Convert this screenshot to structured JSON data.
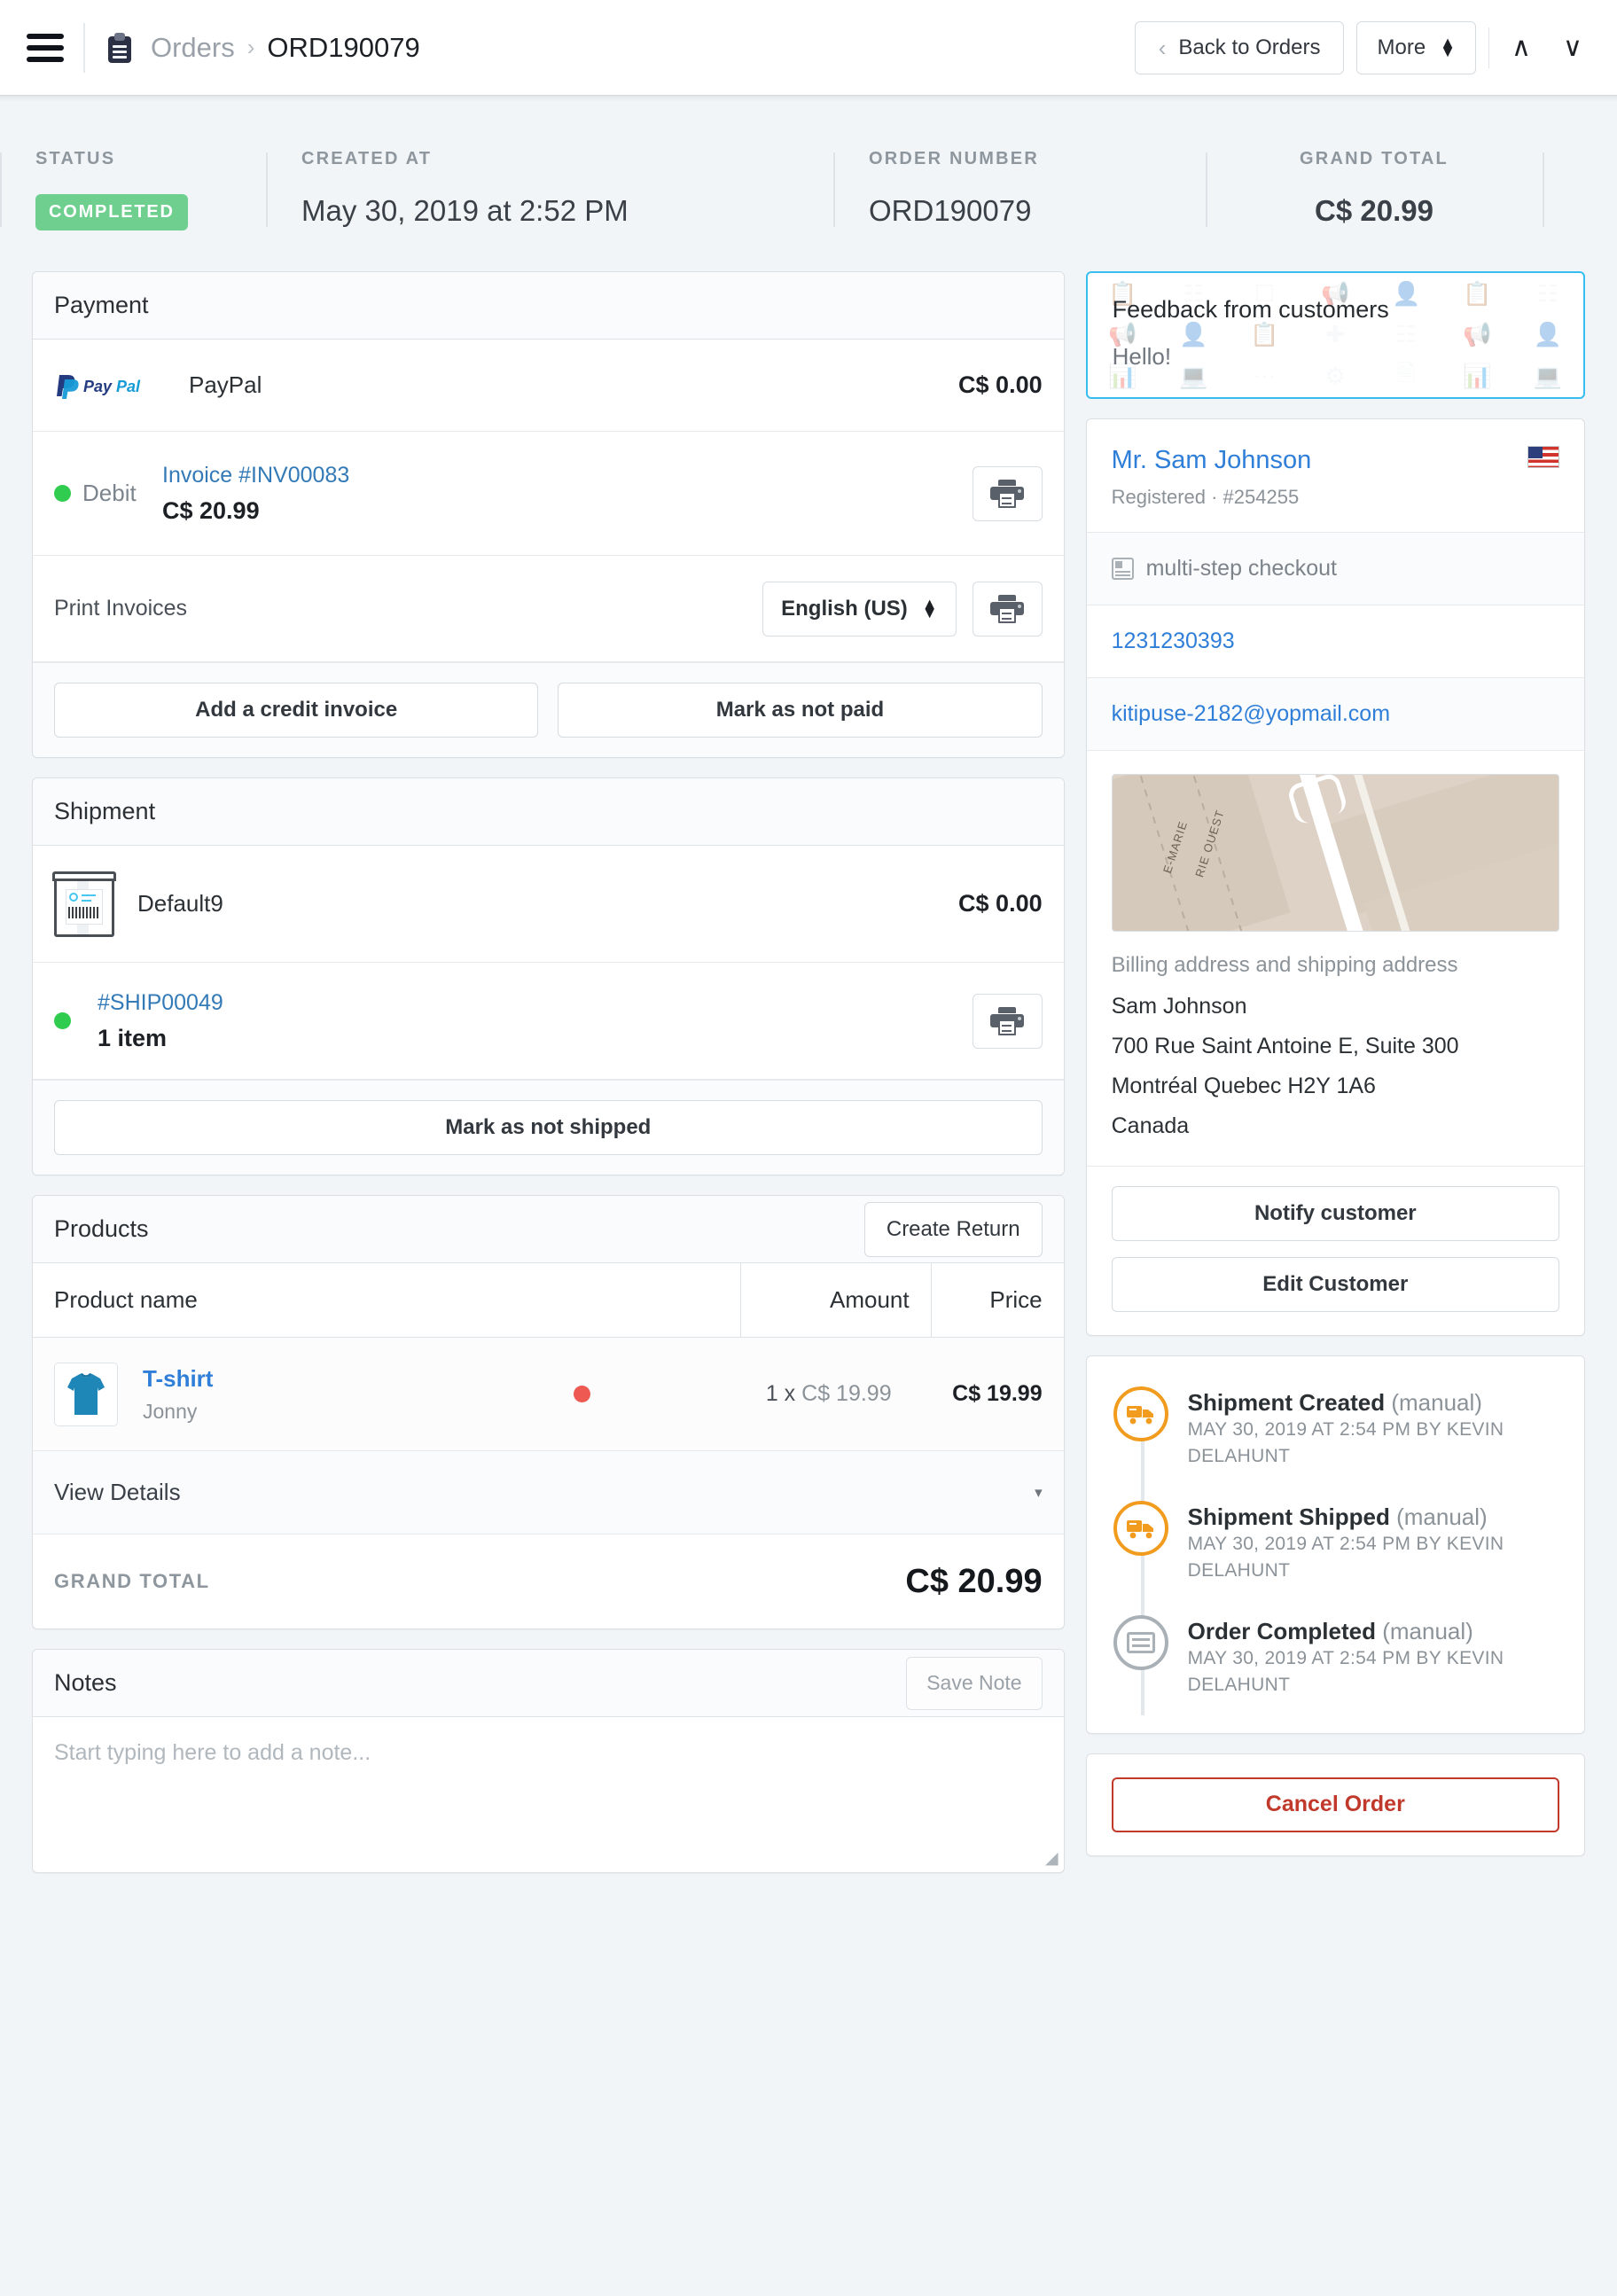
{
  "header": {
    "menu_icon": "hamburger-icon",
    "doc_icon": "clipboard-icon",
    "breadcrumb_parent": "Orders",
    "breadcrumb_sep": "›",
    "breadcrumb_current": "ORD190079",
    "back_label": "Back to Orders",
    "back_chevron": "‹",
    "more_label": "More",
    "prev_arrow": "∧",
    "next_arrow": "∨"
  },
  "summary": {
    "status_label": "STATUS",
    "status_value": "COMPLETED",
    "status_color": "#6fcf8f",
    "created_label": "CREATED AT",
    "created_value": "May 30, 2019 at 2:52 PM",
    "order_label": "ORDER NUMBER",
    "order_value": "ORD190079",
    "total_label": "GRAND TOTAL",
    "total_value": "C$ 20.99"
  },
  "payment": {
    "title": "Payment",
    "method_name": "PayPal",
    "method_amount": "C$ 0.00",
    "paypal_pay": "Pay",
    "paypal_pal": "Pal",
    "debit_label": "Debit",
    "invoice_link": "Invoice #INV00083",
    "invoice_amount": "C$ 20.99",
    "print_invoices_label": "Print Invoices",
    "language_value": "English (US)",
    "add_credit_invoice": "Add a credit invoice",
    "mark_not_paid": "Mark as not paid"
  },
  "shipment": {
    "title": "Shipment",
    "carrier_name": "Default9",
    "carrier_amount": "C$ 0.00",
    "shipment_link": "#SHIP00049",
    "shipment_items": "1 item",
    "mark_not_shipped": "Mark as not shipped"
  },
  "products": {
    "title": "Products",
    "create_return": "Create Return",
    "columns": [
      "Product name",
      "Amount",
      "Price"
    ],
    "rows": [
      {
        "name": "T-shirt",
        "sub": "Jonny",
        "status_color": "#ee5a52",
        "qty_prefix": "1 x",
        "unit_price": "C$ 19.99",
        "price": "C$ 19.99"
      }
    ],
    "view_details": "View Details",
    "view_details_caret": "▾",
    "grand_total_label": "GRAND TOTAL",
    "grand_total_value": "C$ 20.99"
  },
  "notes": {
    "title": "Notes",
    "save_label": "Save Note",
    "placeholder": "Start typing here to add a note..."
  },
  "feedback": {
    "title": "Feedback from customers",
    "message": "Hello!",
    "border_color": "#37bdf0"
  },
  "customer": {
    "name": "Mr. Sam Johnson",
    "meta": "Registered · #254255",
    "flag": "us-flag-icon",
    "checkout_type": "multi-step checkout",
    "phone": "1231230393",
    "email": "kitipuse-2182@yopmail.com",
    "address_label": "Billing address and shipping address",
    "address_lines": [
      "Sam Johnson",
      "700 Rue Saint Antoine E, Suite 300",
      "Montréal Quebec H2Y 1A6",
      "Canada"
    ],
    "map_label_1": "E-MARIE",
    "map_label_2": "RIE OUEST",
    "notify_label": "Notify customer",
    "edit_label": "Edit Customer"
  },
  "timeline": {
    "events": [
      {
        "title": "Shipment Created",
        "suffix": "(manual)",
        "meta": "MAY 30, 2019 AT 2:54 PM BY KEVIN DELAHUNT",
        "icon": "truck-icon",
        "color": "#f29c1f"
      },
      {
        "title": "Shipment Shipped",
        "suffix": "(manual)",
        "meta": "MAY 30, 2019 AT 2:54 PM BY KEVIN DELAHUNT",
        "icon": "truck-icon",
        "color": "#f29c1f"
      },
      {
        "title": "Order Completed",
        "suffix": "(manual)",
        "meta": "MAY 30, 2019 AT 2:54 PM BY KEVIN DELAHUNT",
        "icon": "credit-card-icon",
        "color": "#a9b0b6"
      }
    ]
  },
  "danger": {
    "cancel_label": "Cancel Order"
  }
}
